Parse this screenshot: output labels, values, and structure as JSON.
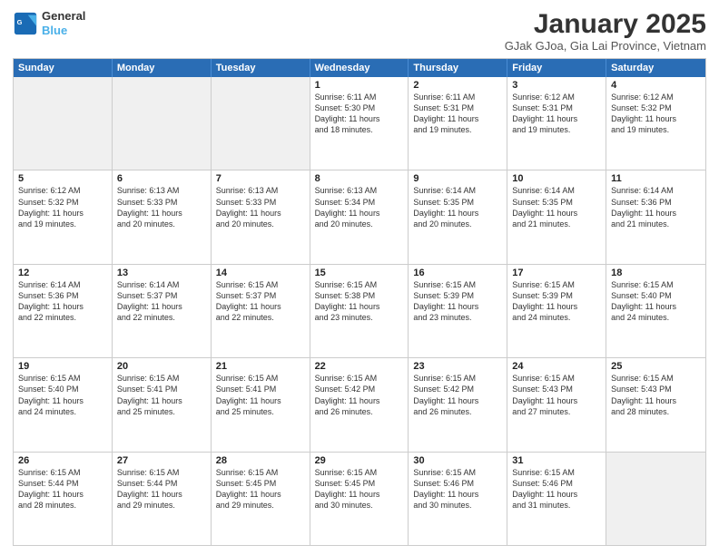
{
  "logo": {
    "line1": "General",
    "line2": "Blue"
  },
  "title": "January 2025",
  "subtitle": "GJak GJoa, Gia Lai Province, Vietnam",
  "header_days": [
    "Sunday",
    "Monday",
    "Tuesday",
    "Wednesday",
    "Thursday",
    "Friday",
    "Saturday"
  ],
  "weeks": [
    [
      {
        "day": "",
        "info": ""
      },
      {
        "day": "",
        "info": ""
      },
      {
        "day": "",
        "info": ""
      },
      {
        "day": "1",
        "info": "Sunrise: 6:11 AM\nSunset: 5:30 PM\nDaylight: 11 hours\nand 18 minutes."
      },
      {
        "day": "2",
        "info": "Sunrise: 6:11 AM\nSunset: 5:31 PM\nDaylight: 11 hours\nand 19 minutes."
      },
      {
        "day": "3",
        "info": "Sunrise: 6:12 AM\nSunset: 5:31 PM\nDaylight: 11 hours\nand 19 minutes."
      },
      {
        "day": "4",
        "info": "Sunrise: 6:12 AM\nSunset: 5:32 PM\nDaylight: 11 hours\nand 19 minutes."
      }
    ],
    [
      {
        "day": "5",
        "info": "Sunrise: 6:12 AM\nSunset: 5:32 PM\nDaylight: 11 hours\nand 19 minutes."
      },
      {
        "day": "6",
        "info": "Sunrise: 6:13 AM\nSunset: 5:33 PM\nDaylight: 11 hours\nand 20 minutes."
      },
      {
        "day": "7",
        "info": "Sunrise: 6:13 AM\nSunset: 5:33 PM\nDaylight: 11 hours\nand 20 minutes."
      },
      {
        "day": "8",
        "info": "Sunrise: 6:13 AM\nSunset: 5:34 PM\nDaylight: 11 hours\nand 20 minutes."
      },
      {
        "day": "9",
        "info": "Sunrise: 6:14 AM\nSunset: 5:35 PM\nDaylight: 11 hours\nand 20 minutes."
      },
      {
        "day": "10",
        "info": "Sunrise: 6:14 AM\nSunset: 5:35 PM\nDaylight: 11 hours\nand 21 minutes."
      },
      {
        "day": "11",
        "info": "Sunrise: 6:14 AM\nSunset: 5:36 PM\nDaylight: 11 hours\nand 21 minutes."
      }
    ],
    [
      {
        "day": "12",
        "info": "Sunrise: 6:14 AM\nSunset: 5:36 PM\nDaylight: 11 hours\nand 22 minutes."
      },
      {
        "day": "13",
        "info": "Sunrise: 6:14 AM\nSunset: 5:37 PM\nDaylight: 11 hours\nand 22 minutes."
      },
      {
        "day": "14",
        "info": "Sunrise: 6:15 AM\nSunset: 5:37 PM\nDaylight: 11 hours\nand 22 minutes."
      },
      {
        "day": "15",
        "info": "Sunrise: 6:15 AM\nSunset: 5:38 PM\nDaylight: 11 hours\nand 23 minutes."
      },
      {
        "day": "16",
        "info": "Sunrise: 6:15 AM\nSunset: 5:39 PM\nDaylight: 11 hours\nand 23 minutes."
      },
      {
        "day": "17",
        "info": "Sunrise: 6:15 AM\nSunset: 5:39 PM\nDaylight: 11 hours\nand 24 minutes."
      },
      {
        "day": "18",
        "info": "Sunrise: 6:15 AM\nSunset: 5:40 PM\nDaylight: 11 hours\nand 24 minutes."
      }
    ],
    [
      {
        "day": "19",
        "info": "Sunrise: 6:15 AM\nSunset: 5:40 PM\nDaylight: 11 hours\nand 24 minutes."
      },
      {
        "day": "20",
        "info": "Sunrise: 6:15 AM\nSunset: 5:41 PM\nDaylight: 11 hours\nand 25 minutes."
      },
      {
        "day": "21",
        "info": "Sunrise: 6:15 AM\nSunset: 5:41 PM\nDaylight: 11 hours\nand 25 minutes."
      },
      {
        "day": "22",
        "info": "Sunrise: 6:15 AM\nSunset: 5:42 PM\nDaylight: 11 hours\nand 26 minutes."
      },
      {
        "day": "23",
        "info": "Sunrise: 6:15 AM\nSunset: 5:42 PM\nDaylight: 11 hours\nand 26 minutes."
      },
      {
        "day": "24",
        "info": "Sunrise: 6:15 AM\nSunset: 5:43 PM\nDaylight: 11 hours\nand 27 minutes."
      },
      {
        "day": "25",
        "info": "Sunrise: 6:15 AM\nSunset: 5:43 PM\nDaylight: 11 hours\nand 28 minutes."
      }
    ],
    [
      {
        "day": "26",
        "info": "Sunrise: 6:15 AM\nSunset: 5:44 PM\nDaylight: 11 hours\nand 28 minutes."
      },
      {
        "day": "27",
        "info": "Sunrise: 6:15 AM\nSunset: 5:44 PM\nDaylight: 11 hours\nand 29 minutes."
      },
      {
        "day": "28",
        "info": "Sunrise: 6:15 AM\nSunset: 5:45 PM\nDaylight: 11 hours\nand 29 minutes."
      },
      {
        "day": "29",
        "info": "Sunrise: 6:15 AM\nSunset: 5:45 PM\nDaylight: 11 hours\nand 30 minutes."
      },
      {
        "day": "30",
        "info": "Sunrise: 6:15 AM\nSunset: 5:46 PM\nDaylight: 11 hours\nand 30 minutes."
      },
      {
        "day": "31",
        "info": "Sunrise: 6:15 AM\nSunset: 5:46 PM\nDaylight: 11 hours\nand 31 minutes."
      },
      {
        "day": "",
        "info": ""
      }
    ]
  ]
}
